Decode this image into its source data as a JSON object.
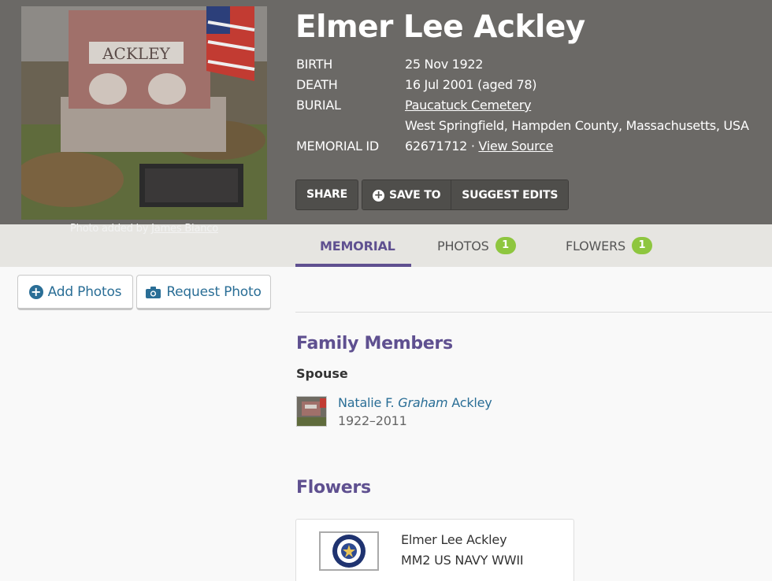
{
  "header": {
    "name": "Elmer Lee Ackley",
    "photo_credit_prefix": "Photo added by ",
    "photo_credit_name": "James Bianco",
    "headstone_text": "ACKLEY",
    "facts": {
      "birth_label": "BIRTH",
      "birth_value": "25 Nov 1922",
      "death_label": "DEATH",
      "death_value": "16 Jul 2001 (aged 78)",
      "burial_label": "BURIAL",
      "burial_cemetery": "Paucatuck Cemetery",
      "burial_location": "West Springfield, Hampden County, Massachusetts, USA",
      "memorial_label": "MEMORIAL ID",
      "memorial_id": "62671712",
      "memorial_sep": " · ",
      "view_source": "View Source"
    },
    "actions": {
      "share": "SHARE",
      "save_to": "SAVE TO",
      "suggest_edits": "SUGGEST EDITS"
    }
  },
  "tabs": [
    {
      "label": "MEMORIAL"
    },
    {
      "label": "PHOTOS",
      "badge": "1"
    },
    {
      "label": "FLOWERS",
      "badge": "1"
    }
  ],
  "sidebar": {
    "add_photos": "Add Photos",
    "request_photo": "Request Photo"
  },
  "family": {
    "title": "Family Members",
    "spouse_heading": "Spouse",
    "spouse": {
      "first": "Natalie F. ",
      "maiden": "Graham",
      "last": " Ackley",
      "dates": "1922–2011"
    }
  },
  "flowers": {
    "title": "Flowers",
    "card": {
      "line1": "Elmer Lee Ackley",
      "line2": "MM2 US NAVY WWII"
    }
  },
  "colors": {
    "header_bg": "#6b6966",
    "accent_purple": "#5f5090",
    "link_blue": "#2a6e96",
    "badge_green": "#8ec63f"
  }
}
